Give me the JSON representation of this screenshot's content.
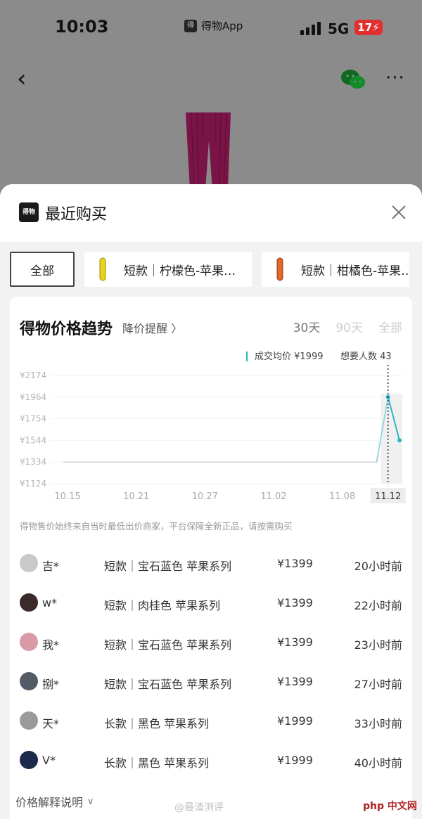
{
  "status_bar": {
    "time": "10:03",
    "app_name": "得物App",
    "app_logo_text": "得物",
    "network": "5G",
    "battery": "17"
  },
  "sheet": {
    "title": "最近购买",
    "logo_text": "得物"
  },
  "filters": [
    {
      "label": "全部",
      "selected": true
    },
    {
      "label": "短款｜柠檬色-苹果…",
      "thumb_color": "#e8d21c"
    },
    {
      "label": "短款｜柑橘色-苹果…",
      "thumb_color": "#e2682a"
    }
  ],
  "card": {
    "title": "得物价格趋势",
    "price_alert": "降价提醒 〉",
    "range_tabs": [
      "30天",
      "90天",
      "全部"
    ],
    "active_range": "30天"
  },
  "chart_data": {
    "type": "line",
    "x_tick_labels": [
      "10.15",
      "10.21",
      "10.27",
      "11.02",
      "11.08",
      "11.12"
    ],
    "y_tick_labels": [
      "¥2174",
      "¥1964",
      "¥1754",
      "¥1544",
      "¥1334",
      "¥1124"
    ],
    "ylim": [
      1124,
      2174
    ],
    "series": [
      {
        "color": "#2bb5c4",
        "points": [
          {
            "x": "10.15",
            "y": 1334
          },
          {
            "x": "11.11",
            "y": 1334
          },
          {
            "x": "11.12",
            "y": 1964
          },
          {
            "x": "11.13",
            "y": 1544
          }
        ]
      }
    ],
    "tooltip": {
      "avg_label": "成交均价 ¥1999",
      "want_label": "想要人数 43"
    },
    "highlight_x": "11.12",
    "grid": true
  },
  "disclaimer": "得物售价始终来自当时最低出价商家，平台保障全新正品，请按需购买",
  "purchases": [
    {
      "buyer": "吉*",
      "variant": "短款｜宝石蓝色 苹果系列",
      "price": "¥1399",
      "ago": "20小时前",
      "avatar_color": "#c9c9c9"
    },
    {
      "buyer": "w*",
      "variant": "短款｜肉桂色 苹果系列",
      "price": "¥1399",
      "ago": "22小时前",
      "avatar_color": "#3a2a2a"
    },
    {
      "buyer": "我*",
      "variant": "短款｜宝石蓝色 苹果系列",
      "price": "¥1399",
      "ago": "23小时前",
      "avatar_color": "#d89aa6"
    },
    {
      "buyer": "捌*",
      "variant": "短款｜宝石蓝色 苹果系列",
      "price": "¥1399",
      "ago": "27小时前",
      "avatar_color": "#555b66"
    },
    {
      "buyer": "天*",
      "variant": "长款｜黑色 苹果系列",
      "price": "¥1999",
      "ago": "33小时前",
      "avatar_color": "#9a9a9a"
    },
    {
      "buyer": "V*",
      "variant": "长款｜黑色 苹果系列",
      "price": "¥1999",
      "ago": "40小时前",
      "avatar_color": "#1e2a4a"
    }
  ],
  "footer": {
    "explain": "价格解释说明",
    "watermark": "@最渣测评",
    "site": "php 中文网"
  },
  "colors": {
    "accent_line": "#2bb5c4",
    "battery_badge": "#e03030"
  }
}
